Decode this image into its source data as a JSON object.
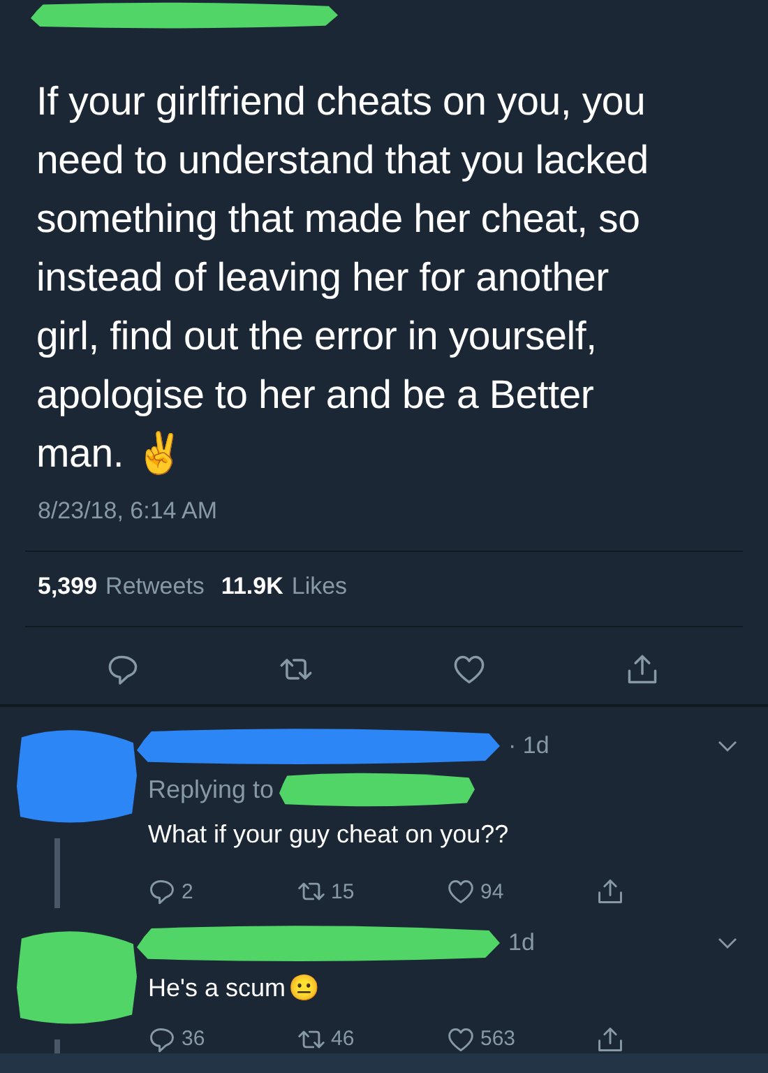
{
  "tweet": {
    "text": "If your girlfriend cheats on you, you need to understand that you lacked something that made her cheat, so instead of leaving her for another girl, find out the error in yourself, apologise to her and be a Better man. ✌️",
    "timestamp": "8/23/18, 6:14 AM",
    "stats": [
      {
        "count": "5,399",
        "label": "Retweets"
      },
      {
        "count": "11.9K",
        "label": "Likes"
      }
    ]
  },
  "replies": [
    {
      "color": "#2c86f5",
      "time": "· 1d",
      "replying_to": "Replying to",
      "text": "What if your guy cheat on you??",
      "replies": "2",
      "retweets": "15",
      "likes": "94"
    },
    {
      "color": "#50d566",
      "time": "1d",
      "text": "He's a scum",
      "emoji": "😐",
      "replies": "36",
      "retweets": "46",
      "likes": "563"
    }
  ]
}
